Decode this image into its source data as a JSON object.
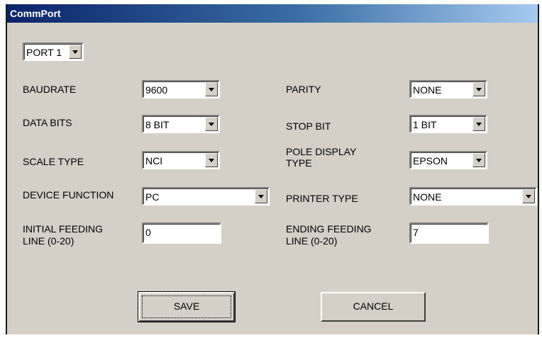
{
  "window": {
    "title": "CommPort"
  },
  "port": {
    "value": "PORT 1"
  },
  "fields": {
    "baudrate": {
      "label": "BAUDRATE",
      "value": "9600"
    },
    "parity": {
      "label": "PARITY",
      "value": "NONE"
    },
    "data_bits": {
      "label": "DATA BITS",
      "value": "8 BIT"
    },
    "stop_bit": {
      "label": "STOP BIT",
      "value": "1 BIT"
    },
    "scale_type": {
      "label": "SCALE TYPE",
      "value": "NCI"
    },
    "pole_display_type": {
      "label_line1": "POLE DISPLAY",
      "label_line2": "TYPE",
      "value": "EPSON"
    },
    "device_function": {
      "label": "DEVICE FUNCTION",
      "value": "PC"
    },
    "printer_type": {
      "label": "PRINTER TYPE",
      "value": "NONE"
    },
    "initial_feeding": {
      "label_line1": "INITIAL FEEDING",
      "label_line2": "LINE (0-20)",
      "value": "0"
    },
    "ending_feeding": {
      "label_line1": "ENDING FEEDING",
      "label_line2": "LINE (0-20)",
      "value": "7"
    }
  },
  "buttons": {
    "save": "SAVE",
    "cancel": "CANCEL"
  },
  "icons": {
    "dropdown": "chevron-down-icon"
  },
  "colors": {
    "dialog_bg": "#d4d0c8",
    "titlebar_start": "#0a246a",
    "titlebar_end": "#a6caf0"
  }
}
